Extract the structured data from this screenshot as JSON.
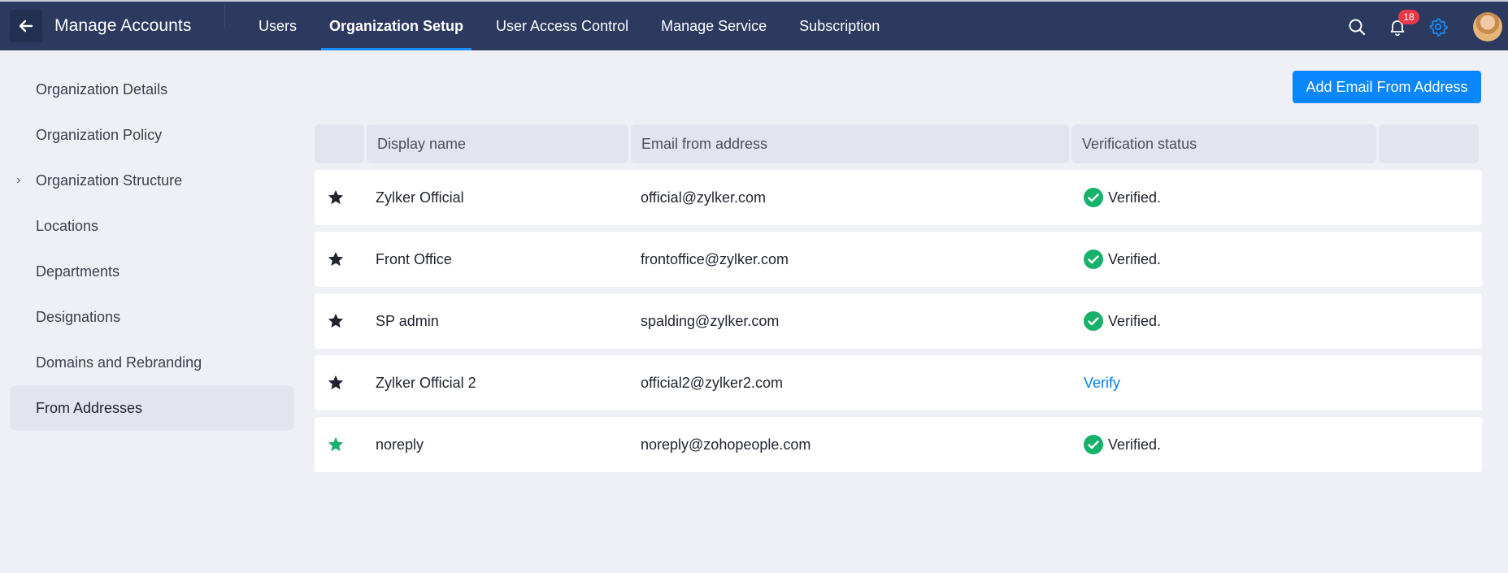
{
  "header": {
    "app_title": "Manage Accounts",
    "tabs": [
      {
        "label": "Users"
      },
      {
        "label": "Organization Setup"
      },
      {
        "label": "User Access Control"
      },
      {
        "label": "Manage Service"
      },
      {
        "label": "Subscription"
      }
    ],
    "active_tab": "Organization Setup",
    "notification_count": "18",
    "icons": [
      "back-arrow-icon",
      "search-icon",
      "bell-icon",
      "gear-icon",
      "avatar"
    ],
    "accent_color": "#1a8cff",
    "bar_color": "#2b3a5e"
  },
  "sidebar": {
    "items": [
      {
        "label": "Organization Details"
      },
      {
        "label": "Organization Policy"
      },
      {
        "label": "Organization Structure"
      },
      {
        "label": "Locations"
      },
      {
        "label": "Departments"
      },
      {
        "label": "Designations"
      },
      {
        "label": "Domains and Rebranding"
      },
      {
        "label": "From Addresses"
      }
    ],
    "active_item": "From Addresses"
  },
  "main": {
    "add_button_label": "Add Email From Address",
    "columns": [
      "Display name",
      "Email from address",
      "Verification status"
    ],
    "rows": [
      {
        "display_name": "Zylker Official",
        "email": "official@zylker.com",
        "status": "Verified.",
        "verified": true,
        "default": false
      },
      {
        "display_name": "Front Office",
        "email": "frontoffice@zylker.com",
        "status": "Verified.",
        "verified": true,
        "default": false
      },
      {
        "display_name": "SP admin",
        "email": "spalding@zylker.com",
        "status": "Verified.",
        "verified": true,
        "default": false
      },
      {
        "display_name": "Zylker Official 2",
        "email": "official2@zylker2.com",
        "status": "Verify",
        "verified": false,
        "default": false
      },
      {
        "display_name": "noreply",
        "email": "noreply@zohopeople.com",
        "status": "Verified.",
        "verified": true,
        "default": true
      }
    ],
    "colors": {
      "verified": "#17b26a",
      "link": "#0a7ee8",
      "default_star": "#17b26a",
      "star": "#1f2330"
    }
  }
}
